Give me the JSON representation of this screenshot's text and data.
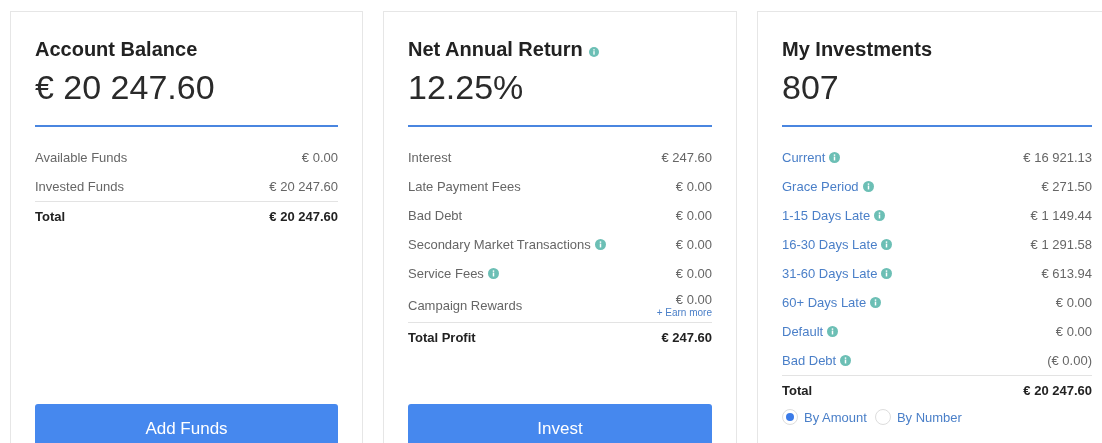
{
  "cards": [
    {
      "title": "Account Balance",
      "title_info": false,
      "figure": "€ 20 247.60",
      "link_rows": false,
      "rows": [
        {
          "label": "Available Funds",
          "value": "€ 0.00",
          "info": false
        },
        {
          "label": "Invested Funds",
          "value": "€ 20 247.60",
          "info": false
        }
      ],
      "total": {
        "label": "Total",
        "value": "€ 20 247.60"
      },
      "button": "Add Funds"
    },
    {
      "title": "Net Annual Return",
      "title_info": true,
      "figure": "12.25%",
      "link_rows": false,
      "rows": [
        {
          "label": "Interest",
          "value": "€ 247.60",
          "info": false
        },
        {
          "label": "Late Payment Fees",
          "value": "€ 0.00",
          "info": false
        },
        {
          "label": "Bad Debt",
          "value": "€ 0.00",
          "info": false
        },
        {
          "label": "Secondary Market Transactions",
          "value": "€ 0.00",
          "info": true
        },
        {
          "label": "Service Fees",
          "value": "€ 0.00",
          "info": true
        },
        {
          "label": "Campaign Rewards",
          "value": "€ 0.00",
          "info": false,
          "link": "+ Earn more"
        }
      ],
      "total": {
        "label": "Total Profit",
        "value": "€ 247.60"
      },
      "button": "Invest"
    },
    {
      "title": "My Investments",
      "title_info": false,
      "figure": "807",
      "link_rows": true,
      "rows": [
        {
          "label": "Current",
          "value": "€ 16 921.13",
          "info": true
        },
        {
          "label": "Grace Period",
          "value": "€ 271.50",
          "info": true
        },
        {
          "label": "1-15 Days Late",
          "value": "€ 1 149.44",
          "info": true
        },
        {
          "label": "16-30 Days Late",
          "value": "€ 1 291.58",
          "info": true
        },
        {
          "label": "31-60 Days Late",
          "value": "€ 613.94",
          "info": true
        },
        {
          "label": "60+ Days Late",
          "value": "€ 0.00",
          "info": true
        },
        {
          "label": "Default",
          "value": "€ 0.00",
          "info": true
        },
        {
          "label": "Bad Debt",
          "value": "(€ 0.00)",
          "info": true
        }
      ],
      "total": {
        "label": "Total",
        "value": "€ 20 247.60"
      },
      "radios": [
        {
          "label": "By Amount",
          "selected": true
        },
        {
          "label": "By Number",
          "selected": false
        }
      ]
    }
  ]
}
